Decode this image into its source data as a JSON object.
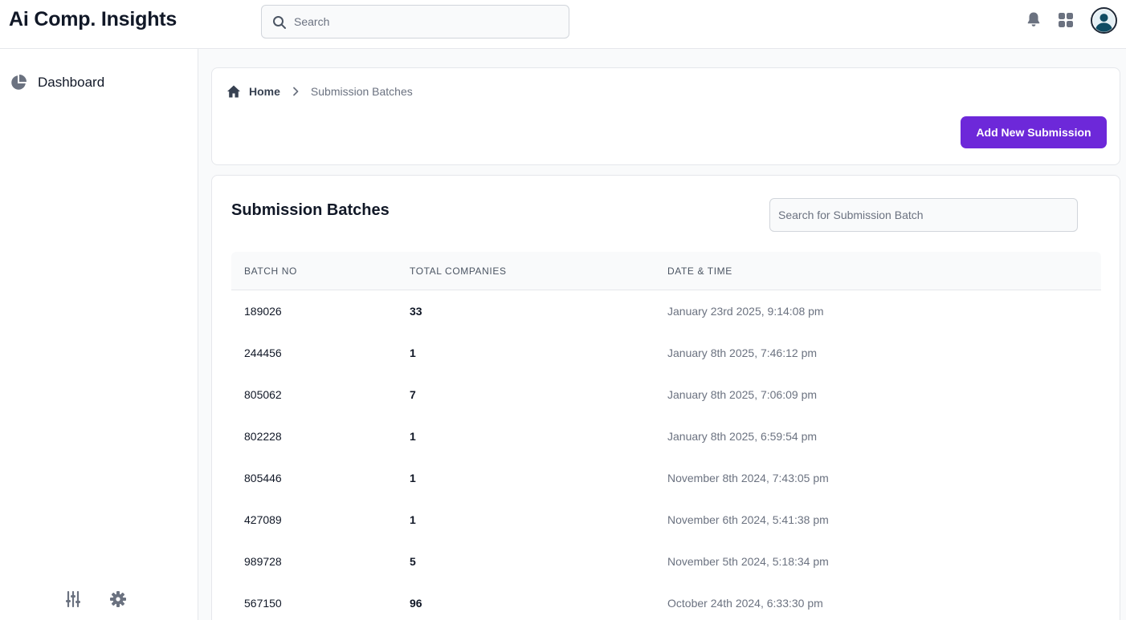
{
  "app": {
    "title": "Ai Comp. Insights"
  },
  "header": {
    "search_placeholder": "Search",
    "icons": [
      "bell-icon",
      "apps-grid-icon",
      "user-avatar-icon"
    ]
  },
  "sidebar": {
    "items": [
      {
        "label": "Dashboard",
        "icon": "pie-chart-icon"
      }
    ],
    "bottom_icons": [
      "sliders-icon",
      "gear-icon"
    ]
  },
  "breadcrumb": {
    "home": "Home",
    "current": "Submission Batches"
  },
  "actions": {
    "add_label": "Add New Submission"
  },
  "section": {
    "title": "Submission Batches",
    "search_placeholder": "Search for Submission Batch"
  },
  "table": {
    "headers": [
      "BATCH NO",
      "TOTAL COMPANIES",
      "DATE & TIME"
    ],
    "rows": [
      {
        "batch": "189026",
        "companies": "33",
        "datetime": "January 23rd 2025, 9:14:08 pm"
      },
      {
        "batch": "244456",
        "companies": "1",
        "datetime": "January 8th 2025, 7:46:12 pm"
      },
      {
        "batch": "805062",
        "companies": "7",
        "datetime": "January 8th 2025, 7:06:09 pm"
      },
      {
        "batch": "802228",
        "companies": "1",
        "datetime": "January 8th 2025, 6:59:54 pm"
      },
      {
        "batch": "805446",
        "companies": "1",
        "datetime": "November 8th 2024, 7:43:05 pm"
      },
      {
        "batch": "427089",
        "companies": "1",
        "datetime": "November 6th 2024, 5:41:38 pm"
      },
      {
        "batch": "989728",
        "companies": "5",
        "datetime": "November 5th 2024, 5:18:34 pm"
      },
      {
        "batch": "567150",
        "companies": "96",
        "datetime": "October 24th 2024, 6:33:30 pm"
      }
    ]
  },
  "colors": {
    "accent": "#6d28d9",
    "text": "#111827",
    "muted": "#6b7280",
    "border": "#e5e7eb"
  }
}
